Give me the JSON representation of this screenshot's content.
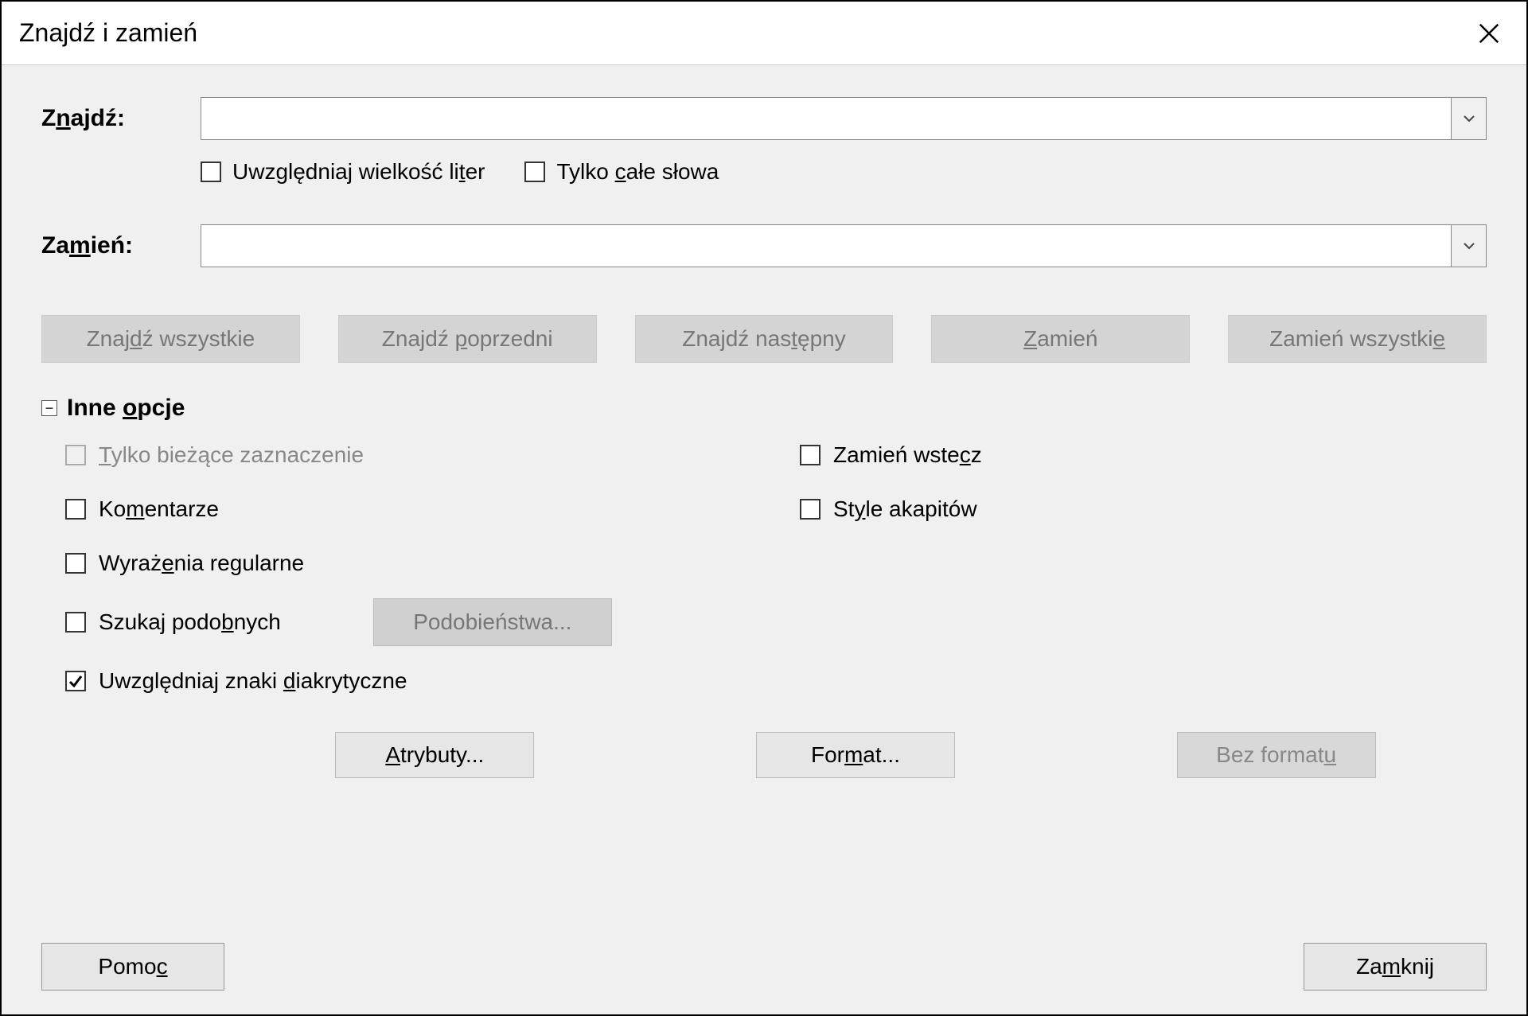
{
  "title": "Znajdź i zamień",
  "find": {
    "label_pre": "Z",
    "label_ul": "n",
    "label_post": "ajdź:",
    "value": ""
  },
  "replace": {
    "label_pre": "Za",
    "label_ul": "m",
    "label_post": "ień:",
    "value": ""
  },
  "find_options": {
    "case_pre": "Uwzględniaj wielkość li",
    "case_ul": "t",
    "case_post": "er",
    "case_checked": false,
    "whole_pre": "Tylko ",
    "whole_ul": "c",
    "whole_post": "ałe słowa",
    "whole_checked": false
  },
  "buttons": {
    "find_all_pre": "Znaj",
    "find_all_ul": "d",
    "find_all_post": "ź wszystkie",
    "find_prev_pre": "Znajdź ",
    "find_prev_ul": "p",
    "find_prev_post": "oprzedni",
    "find_next_pre": "Znajdź nas",
    "find_next_ul": "t",
    "find_next_post": "ępny",
    "replace_pre": "",
    "replace_ul": "Z",
    "replace_post": "amień",
    "replace_all_pre": "Zamień wszystki",
    "replace_all_ul": "e",
    "replace_all_post": ""
  },
  "other_section": {
    "label_pre": "Inne ",
    "label_ul": "o",
    "label_post": "pcje",
    "expanded": true,
    "expander_symbol": "−"
  },
  "opts": {
    "selection_pre": "",
    "selection_ul": "T",
    "selection_post": "ylko bieżące zaznaczenie",
    "selection_disabled": true,
    "backwards_pre": "Zamień wste",
    "backwards_ul": "c",
    "backwards_post": "z",
    "backwards_checked": false,
    "comments_pre": "Ko",
    "comments_ul": "m",
    "comments_post": "entarze",
    "comments_checked": false,
    "para_styles_pre": "St",
    "para_styles_ul": "y",
    "para_styles_post": "le akapitów",
    "para_styles_checked": false,
    "regex_pre": "Wyraż",
    "regex_ul": "e",
    "regex_post": "nia regularne",
    "regex_checked": false,
    "similar_pre": "Szukaj podo",
    "similar_ul": "b",
    "similar_post": "nych",
    "similar_checked": false,
    "similarities_btn": "Podobieństwa...",
    "diacritics_pre": "Uwzględniaj znaki ",
    "diacritics_ul": "d",
    "diacritics_post": "iakrytyczne",
    "diacritics_checked": true
  },
  "format_buttons": {
    "attributes_pre": "",
    "attributes_ul": "A",
    "attributes_post": "trybuty...",
    "format_pre": "For",
    "format_ul": "m",
    "format_post": "at...",
    "no_format_pre": "Bez format",
    "no_format_ul": "u",
    "no_format_post": ""
  },
  "footer": {
    "help_pre": "Pomo",
    "help_ul": "c",
    "help_post": "",
    "close_pre": "Za",
    "close_ul": "m",
    "close_post": "knij"
  }
}
